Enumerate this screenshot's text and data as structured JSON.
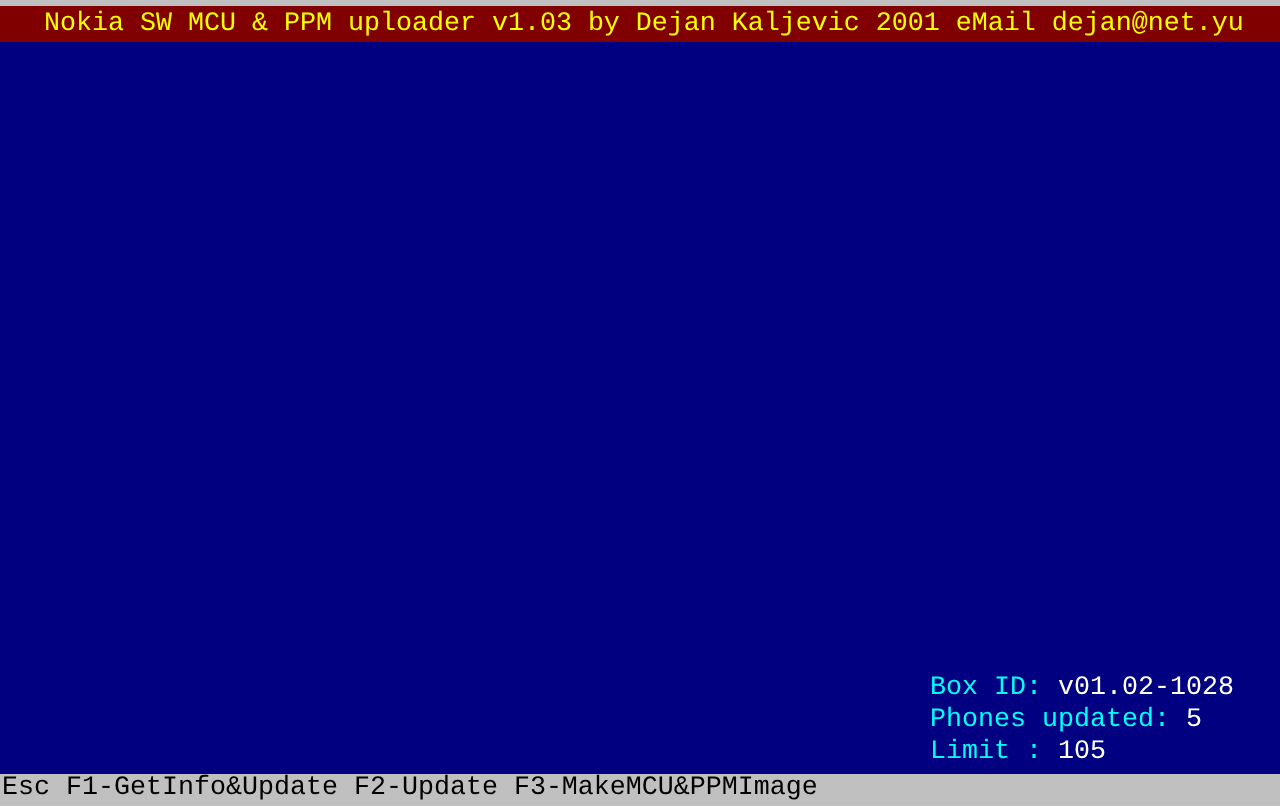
{
  "title_bar": {
    "title": "Nokia SW MCU & PPM uploader v1.03 by Dejan Kaljevic 2001 eMail dejan@net.yu"
  },
  "info": [
    {
      "label": "Box ID:",
      "value": "v01.02-1028"
    },
    {
      "label": "Phones updated:",
      "value": "5"
    },
    {
      "label": "Limit :",
      "value": "105"
    }
  ],
  "status_bar": {
    "text": "Esc F1-GetInfo&Update F2-Update F3-MakeMCU&PPMImage"
  }
}
